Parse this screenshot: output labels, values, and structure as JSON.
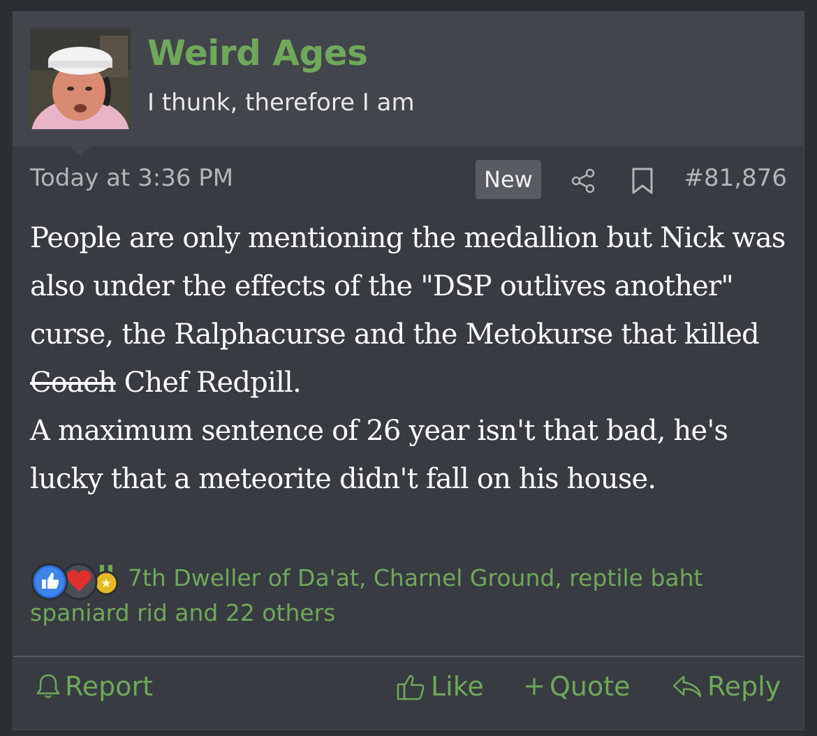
{
  "user": {
    "name": "Weird Ages",
    "title": "I thunk, therefore I am"
  },
  "meta": {
    "date": "Today at 3:36 PM",
    "new_badge": "New",
    "post_number": "#81,876"
  },
  "body": {
    "line1": "People are only mentioning the medallion but Nick was also under the effects of the \"DSP outlives another\" curse, the Ralphacurse and the Metokurse that killed ",
    "struck": "Coach",
    "line1_end": " Chef Redpill.",
    "line2": "A maximum sentence of 26 year isn't that bad, he's lucky that a meteorite didn't fall on his house."
  },
  "reactions": {
    "icons": [
      "like-icon",
      "heart-icon",
      "medal-icon"
    ],
    "text": "7th Dweller of Da'at, Charnel Ground, reptile baht spaniard rid and 22 others"
  },
  "footer": {
    "report": "Report",
    "like": "Like",
    "quote": "Quote",
    "reply": "Reply"
  },
  "colors": {
    "accent": "#6fa85a",
    "background": "#383b42",
    "header": "#42454c"
  }
}
